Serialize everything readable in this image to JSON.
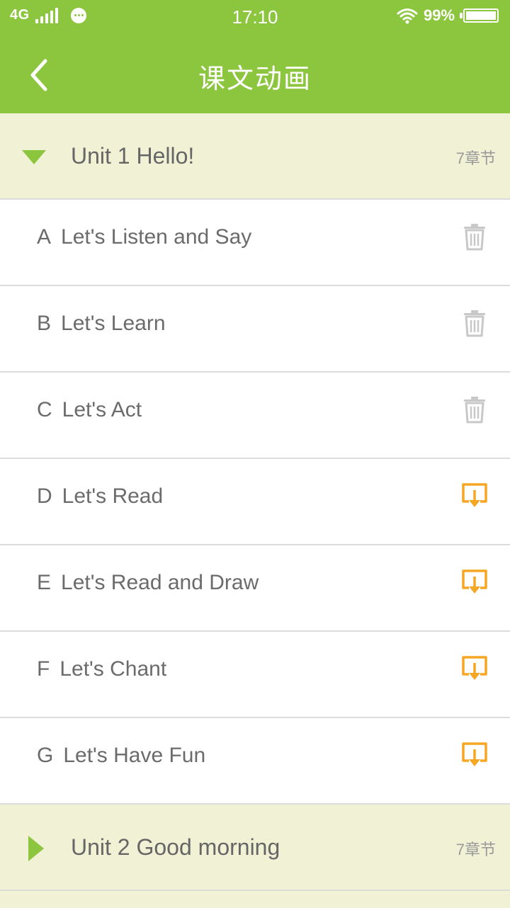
{
  "status_bar": {
    "network": "4G",
    "time": "17:10",
    "battery_percent": "99%",
    "battery_level": 0.99
  },
  "nav": {
    "title": "课文动画",
    "back_icon": "chevron-left-icon"
  },
  "colors": {
    "brand_green": "#8cc63f",
    "unit_header_bg": "#f1f1d6",
    "text_gray": "#6b6b6b",
    "delete_icon": "#c8c8c8",
    "download_icon": "#f5a623"
  },
  "units": [
    {
      "title": "Unit 1 Hello!",
      "count": "7章节",
      "expanded": true,
      "lessons": [
        {
          "letter": "A",
          "title": "Let's Listen and Say",
          "action": "trash-icon"
        },
        {
          "letter": "B",
          "title": "Let's Learn",
          "action": "trash-icon"
        },
        {
          "letter": "C",
          "title": "Let's Act",
          "action": "trash-icon"
        },
        {
          "letter": "D",
          "title": "Let's Read",
          "action": "download-icon"
        },
        {
          "letter": "E",
          "title": "Let's Read and Draw",
          "action": "download-icon"
        },
        {
          "letter": "F",
          "title": "Let's Chant",
          "action": "download-icon"
        },
        {
          "letter": "G",
          "title": "Let's Have Fun",
          "action": "download-icon"
        }
      ]
    },
    {
      "title": "Unit 2 Good morning",
      "count": "7章节",
      "expanded": false,
      "lessons": []
    }
  ]
}
